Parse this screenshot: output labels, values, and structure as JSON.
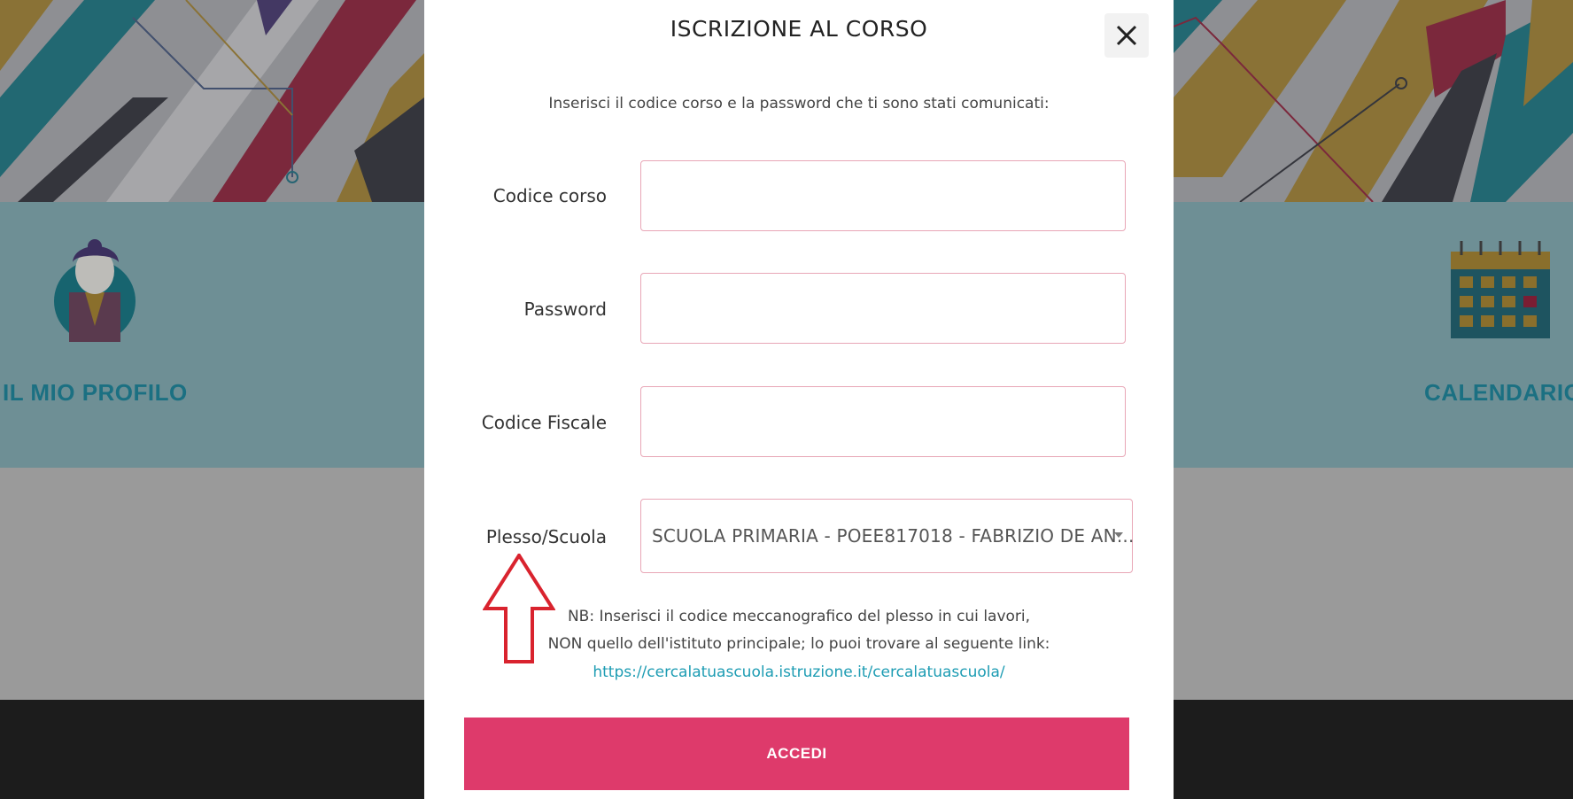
{
  "background": {
    "profile_card_label": "IL MIO PROFILO",
    "calendar_card_label": "CALENDARIO"
  },
  "modal": {
    "title": "ISCRIZIONE AL CORSO",
    "close_symbol": "✕",
    "instruction": "Inserisci il codice corso e la password che ti sono stati comunicati:",
    "fields": {
      "course_code": {
        "label": "Codice corso",
        "value": ""
      },
      "password": {
        "label": "Password",
        "value": ""
      },
      "tax_code": {
        "label": "Codice Fiscale",
        "value": ""
      },
      "school": {
        "label": "Plesso/Scuola",
        "selected": "SCUOLA PRIMARIA - POEE817018 - FABRIZIO DE AN..."
      }
    },
    "note_line1": "NB: Inserisci il codice meccanografico del plesso in cui lavori,",
    "note_line2": "NON quello dell'istituto principale; lo puoi trovare al seguente link:",
    "note_link": "https://cercalatuascuola.istruzione.it/cercalatuascuola/",
    "submit_label": "ACCEDI"
  },
  "colors": {
    "accent": "#de3a6b",
    "field_border": "#e8a6b6",
    "link": "#1d9cb3",
    "annotation_arrow": "#d9232e"
  },
  "icons": [
    "close-icon",
    "caret-down-icon",
    "avatar-icon",
    "calendar-icon",
    "annotation-arrow-icon"
  ]
}
